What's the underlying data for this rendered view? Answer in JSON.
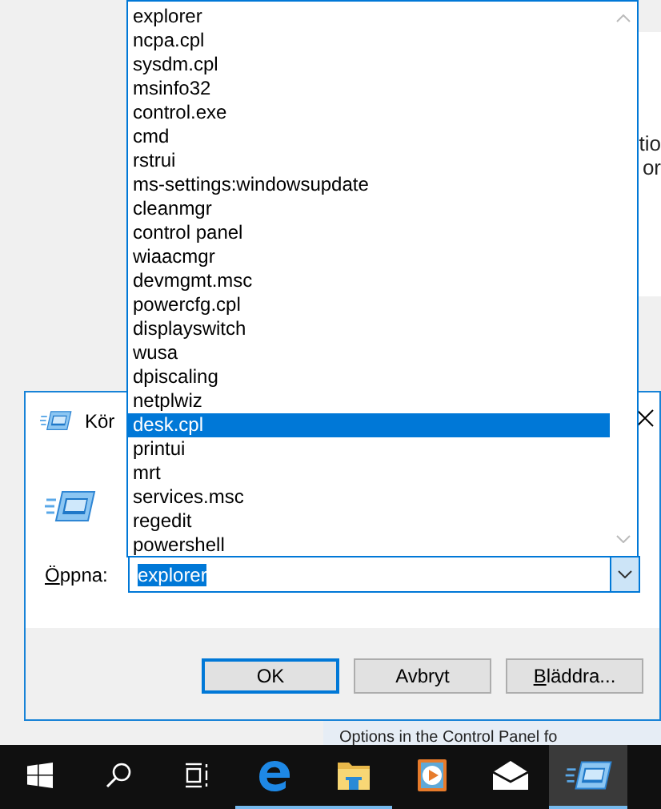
{
  "background_window": {
    "fragments": [
      "tio",
      "or"
    ],
    "caption": "Options in the Control Panel fo"
  },
  "dialog": {
    "title": "Kör",
    "open_label": "Öppna:",
    "open_label_accesskey_underlined": true,
    "command": {
      "value": "explorer",
      "text_selected": true
    },
    "dropdown": {
      "items": [
        {
          "label": "explorer",
          "selected": false
        },
        {
          "label": "ncpa.cpl",
          "selected": false
        },
        {
          "label": "sysdm.cpl",
          "selected": false
        },
        {
          "label": "msinfo32",
          "selected": false
        },
        {
          "label": "control.exe",
          "selected": false
        },
        {
          "label": "cmd",
          "selected": false
        },
        {
          "label": "rstrui",
          "selected": false
        },
        {
          "label": "ms-settings:windowsupdate",
          "selected": false
        },
        {
          "label": "cleanmgr",
          "selected": false
        },
        {
          "label": "control panel",
          "selected": false
        },
        {
          "label": "wiaacmgr",
          "selected": false
        },
        {
          "label": "devmgmt.msc",
          "selected": false
        },
        {
          "label": "powercfg.cpl",
          "selected": false
        },
        {
          "label": "displayswitch",
          "selected": false
        },
        {
          "label": "wusa",
          "selected": false
        },
        {
          "label": "dpiscaling",
          "selected": false
        },
        {
          "label": "netplwiz",
          "selected": false
        },
        {
          "label": "desk.cpl",
          "selected": true
        },
        {
          "label": "printui",
          "selected": false
        },
        {
          "label": "mrt",
          "selected": false
        },
        {
          "label": "services.msc",
          "selected": false
        },
        {
          "label": "regedit",
          "selected": false
        },
        {
          "label": "powershell",
          "selected": false
        }
      ]
    },
    "buttons": [
      {
        "label": "OK",
        "default": true
      },
      {
        "label": "Avbryt",
        "default": false
      },
      {
        "label": "Bläddra...",
        "default": false,
        "accesskey_underlined": true
      }
    ]
  },
  "taskbar": {
    "items": [
      {
        "kind": "start",
        "running": false,
        "active": false
      },
      {
        "kind": "search",
        "running": false,
        "active": false
      },
      {
        "kind": "taskview",
        "running": false,
        "active": false
      },
      {
        "kind": "browser",
        "running": true,
        "active": false
      },
      {
        "kind": "folder",
        "running": true,
        "active": false
      },
      {
        "kind": "media",
        "running": false,
        "active": false
      },
      {
        "kind": "mail",
        "running": false,
        "active": false
      },
      {
        "kind": "run",
        "running": true,
        "active": true
      }
    ]
  }
}
